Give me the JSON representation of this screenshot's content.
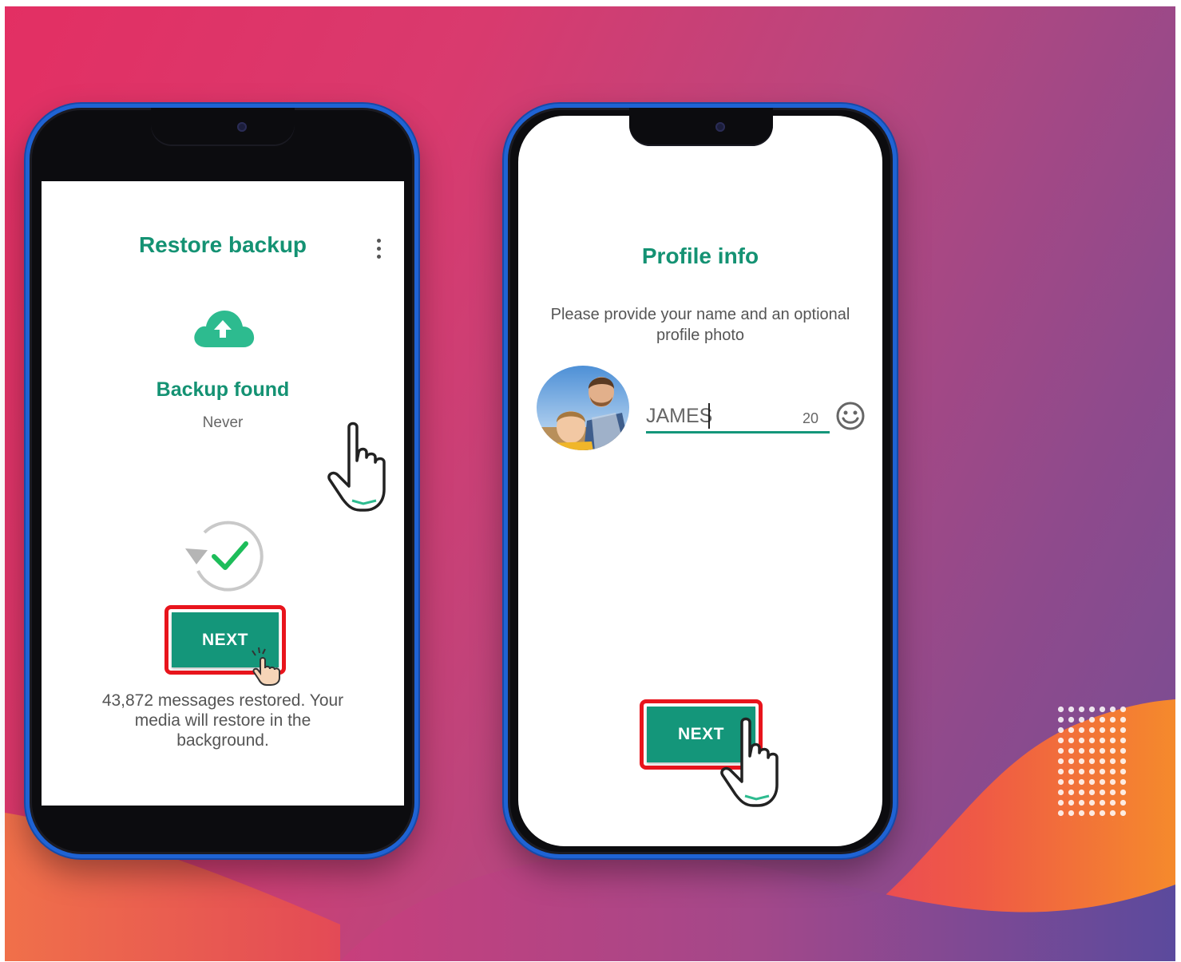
{
  "restore_screen": {
    "title": "Restore backup",
    "status_heading": "Backup found",
    "status_detail": "Never",
    "next_label": "NEXT",
    "restore_message": "43,872 messages restored. Your media will restore in the background."
  },
  "profile_screen": {
    "title": "Profile info",
    "subtitle": "Please provide your name and an optional profile photo",
    "name_value": "JAMES",
    "char_counter": "20",
    "next_label": "NEXT"
  },
  "colors": {
    "accent_green": "#149273",
    "button_green": "#14967a",
    "highlight_red": "#e8141c",
    "phone_frame_blue": "#1f63d4"
  },
  "icons": [
    "cloud-upload-icon",
    "restore-check-icon",
    "more-vert-icon",
    "emoji-icon",
    "pointer-hand-icon",
    "profile-photo-avatar"
  ]
}
